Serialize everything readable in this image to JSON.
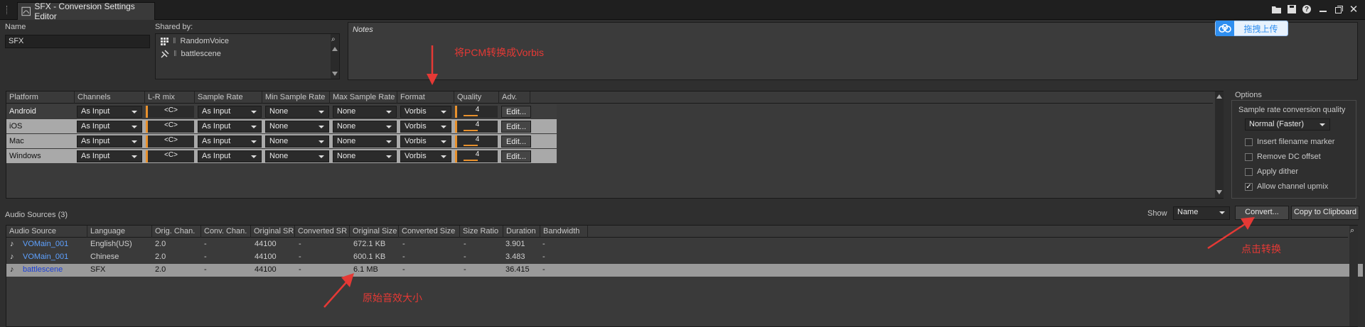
{
  "window": {
    "title": "SFX - Conversion Settings Editor"
  },
  "name_field": {
    "label": "Name",
    "value": "SFX"
  },
  "shared": {
    "label": "Shared by:",
    "items": [
      "RandomVoice",
      "battlescene"
    ]
  },
  "notes": {
    "label": "Notes"
  },
  "upload_button": "拖拽上传",
  "annotations": {
    "vorbis": "将PCM转换成Vorbis",
    "convert": "点击转换",
    "original": "原始音效大小"
  },
  "platform_table": {
    "headers": [
      "Platform",
      "Channels",
      "L-R mix",
      "Sample Rate",
      "Min Sample Rate",
      "Max Sample Rate",
      "Format",
      "Quality",
      "Adv."
    ],
    "rows": [
      {
        "platform": "Android",
        "channels": "As Input",
        "mix": "<C>",
        "sample_rate": "As Input",
        "min_sr": "None",
        "max_sr": "None",
        "format": "Vorbis",
        "quality": "4",
        "adv": "Edit..."
      },
      {
        "platform": "iOS",
        "channels": "As Input",
        "mix": "<C>",
        "sample_rate": "As Input",
        "min_sr": "None",
        "max_sr": "None",
        "format": "Vorbis",
        "quality": "4",
        "adv": "Edit..."
      },
      {
        "platform": "Mac",
        "channels": "As Input",
        "mix": "<C>",
        "sample_rate": "As Input",
        "min_sr": "None",
        "max_sr": "None",
        "format": "Vorbis",
        "quality": "4",
        "adv": "Edit..."
      },
      {
        "platform": "Windows",
        "channels": "As Input",
        "mix": "<C>",
        "sample_rate": "As Input",
        "min_sr": "None",
        "max_sr": "None",
        "format": "Vorbis",
        "quality": "4",
        "adv": "Edit..."
      }
    ]
  },
  "options": {
    "title": "Options",
    "src_quality_label": "Sample rate conversion quality",
    "src_quality_value": "Normal (Faster)",
    "checks": [
      {
        "label": "Insert filename marker",
        "checked": false
      },
      {
        "label": "Remove DC offset",
        "checked": false
      },
      {
        "label": "Apply dither",
        "checked": false
      },
      {
        "label": "Allow channel upmix",
        "checked": true
      }
    ]
  },
  "sources": {
    "title": "Audio Sources (3)",
    "show_label": "Show",
    "show_value": "Name",
    "convert_button": "Convert...",
    "copy_button": "Copy to Clipboard",
    "headers": [
      "Audio Source",
      "Language",
      "Orig. Chan.",
      "Conv. Chan.",
      "Original SR",
      "Converted SR",
      "Original Size",
      "Converted Size",
      "Size Ratio",
      "Duration",
      "Bandwidth"
    ],
    "rows": [
      {
        "name": "VOMain_001",
        "language": "English(US)",
        "orig_chan": "2.0",
        "conv_chan": "-",
        "orig_sr": "44100",
        "conv_sr": "-",
        "orig_size": "672.1 KB",
        "conv_size": "-",
        "ratio": "-",
        "duration": "3.901",
        "bandwidth": "-"
      },
      {
        "name": "VOMain_001",
        "language": "Chinese",
        "orig_chan": "2.0",
        "conv_chan": "-",
        "orig_sr": "44100",
        "conv_sr": "-",
        "orig_size": "600.1 KB",
        "conv_size": "-",
        "ratio": "-",
        "duration": "3.483",
        "bandwidth": "-"
      },
      {
        "name": "battlescene",
        "language": "SFX",
        "orig_chan": "2.0",
        "conv_chan": "-",
        "orig_sr": "44100",
        "conv_sr": "-",
        "orig_size": "6.1 MB",
        "conv_size": "-",
        "ratio": "-",
        "duration": "36.415",
        "bandwidth": "-"
      }
    ]
  }
}
